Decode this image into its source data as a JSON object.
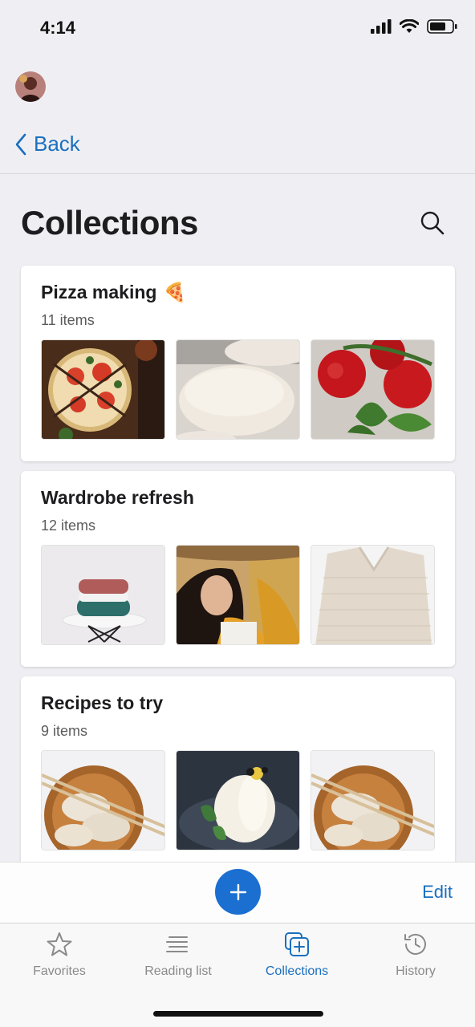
{
  "status": {
    "time": "4:14"
  },
  "nav": {
    "back_label": "Back"
  },
  "page": {
    "title": "Collections"
  },
  "collections": [
    {
      "title": "Pizza making",
      "emoji": "🍕",
      "count": "11 items"
    },
    {
      "title": "Wardrobe refresh",
      "emoji": "",
      "count": "12 items"
    },
    {
      "title": "Recipes to try",
      "emoji": "",
      "count": "9 items"
    }
  ],
  "actions": {
    "edit_label": "Edit"
  },
  "tabs": [
    {
      "label": "Favorites",
      "icon": "star-icon"
    },
    {
      "label": "Reading list",
      "icon": "reading-list-icon"
    },
    {
      "label": "Collections",
      "icon": "collections-icon",
      "active": true
    },
    {
      "label": "History",
      "icon": "history-icon"
    }
  ],
  "colors": {
    "accent": "#1a6fbf",
    "fab": "#1a6fd1"
  }
}
